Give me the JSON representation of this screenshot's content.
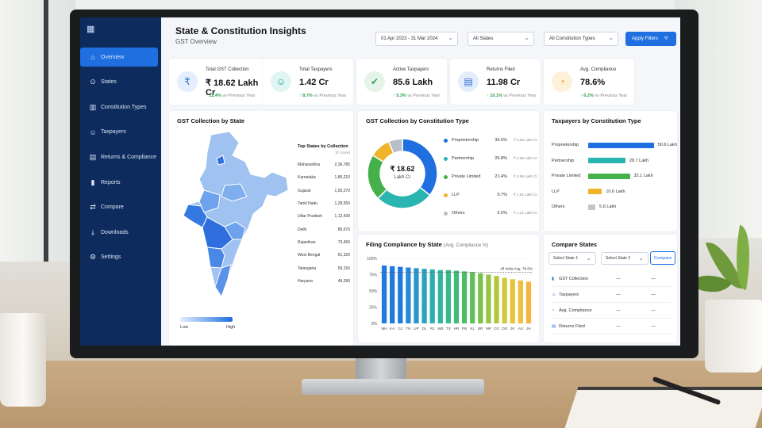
{
  "nav": {
    "items": [
      {
        "icon": "home-icon",
        "glyph": "⌂",
        "label": "Overview"
      },
      {
        "icon": "location-pin-icon",
        "glyph": "⊙",
        "label": "States"
      },
      {
        "icon": "building-icon",
        "glyph": "▥",
        "label": "Constitution Types"
      },
      {
        "icon": "users-icon",
        "glyph": "☺",
        "label": "Taxpayers"
      },
      {
        "icon": "document-icon",
        "glyph": "▤",
        "label": "Returns & Compliance"
      },
      {
        "icon": "bar-chart-icon",
        "glyph": "▮",
        "label": "Reports"
      },
      {
        "icon": "compare-arrows-icon",
        "glyph": "⇄",
        "label": "Compare"
      },
      {
        "icon": "download-icon",
        "glyph": "⤓",
        "label": "Downloads"
      },
      {
        "icon": "gear-icon",
        "glyph": "⚙",
        "label": "Settings"
      }
    ]
  },
  "header": {
    "title": "State & Constitution Insights",
    "subtitle": "GST Overview",
    "date_range": "01 Apr 2023 - 31 Mar 2024",
    "state_filter": "All States",
    "constitution_filter": "All Constitution Types",
    "apply_label": "Apply Filters"
  },
  "kpis": [
    {
      "label": "Total GST Collection",
      "value": "₹ 18.62 Lakh Cr",
      "change": "↑ 12.4%",
      "note": "vs Previous Year",
      "glyph": "₹",
      "color": "#1f6fe0",
      "bg": "#e4eefc"
    },
    {
      "label": "Total Taxpayers",
      "value": "1.42 Cr",
      "change": "↑ 8.7%",
      "note": "vs Previous Year",
      "glyph": "☺",
      "color": "#18a89a",
      "bg": "#e1f5f2"
    },
    {
      "label": "Active Taxpayers",
      "value": "85.6 Lakh",
      "change": "↑ 5.3%",
      "note": "vs Previous Year",
      "glyph": "✔",
      "color": "#3aa655",
      "bg": "#e5f4e8"
    },
    {
      "label": "Returns Filed",
      "value": "11.98 Cr",
      "change": "↑ 10.1%",
      "note": "vs Previous Year",
      "glyph": "▤",
      "color": "#2d6fd6",
      "bg": "#e4edfb"
    },
    {
      "label": "Avg. Compliance",
      "value": "78.6%",
      "change": "↑ 6.2%",
      "note": "vs Previous Year",
      "glyph": "◔",
      "color": "#f0a21d",
      "bg": "#fdf1dc"
    }
  ],
  "state_map": {
    "title": "GST Collection by State",
    "legend_low": "Low",
    "legend_high": "High",
    "table_title": "Top States by Collection",
    "table_unit": "(₹ Crore)",
    "rows": [
      {
        "state": "Maharashtra",
        "value": "2,36,785"
      },
      {
        "state": "Karnataka",
        "value": "1,85,210"
      },
      {
        "state": "Gujarat",
        "value": "1,50,270"
      },
      {
        "state": "Tamil Nadu",
        "value": "1,28,550"
      },
      {
        "state": "Uttar Pradesh",
        "value": "1,12,430"
      },
      {
        "state": "Delhi",
        "value": "85,670"
      },
      {
        "state": "Rajasthan",
        "value": "73,450"
      },
      {
        "state": "West Bengal",
        "value": "61,320"
      },
      {
        "state": "Telangana",
        "value": "59,150"
      },
      {
        "state": "Haryana",
        "value": "49,280"
      }
    ]
  },
  "donut": {
    "title": "GST Collection by Constitution Type",
    "center_value": "₹ 18.62",
    "center_unit": "Lakh Cr",
    "items": [
      {
        "name": "Proprietorship",
        "pct": "35.6%",
        "share": 35.6,
        "amt": "₹ 6.63 Lakh Cr",
        "color": "#1f6fe0"
      },
      {
        "name": "Partnership",
        "pct": "26.8%",
        "share": 26.8,
        "amt": "₹ 4.99 Lakh Cr",
        "color": "#2bb5b0"
      },
      {
        "name": "Private Limited",
        "pct": "21.4%",
        "share": 21.4,
        "amt": "₹ 3.98 Lakh Cr",
        "color": "#46b04a"
      },
      {
        "name": "LLP",
        "pct": "9.7%",
        "share": 9.7,
        "amt": "₹ 1.81 Lakh Cr",
        "color": "#f0b429"
      },
      {
        "name": "Others",
        "pct": "6.5%",
        "share": 6.5,
        "amt": "₹ 1.21 Lakh Cr",
        "color": "#b8bdc6"
      }
    ]
  },
  "taxpayers": {
    "title": "Taxpayers by Constitution Type",
    "items": [
      {
        "name": "Proprietorship",
        "value": 50.6,
        "label": "50.6 Lakh",
        "color": "#1f6fe0"
      },
      {
        "name": "Partnership",
        "value": 28.7,
        "label": "28.7 Lakh",
        "color": "#2bb5b0"
      },
      {
        "name": "Private Limited",
        "value": 32.1,
        "label": "32.1 Lakh",
        "color": "#46b04a"
      },
      {
        "name": "LLP",
        "value": 10.6,
        "label": "10.6 Lakh",
        "color": "#f0b429"
      },
      {
        "name": "Others",
        "value": 5.6,
        "label": "5.6 Lakh",
        "color": "#c0c4cc"
      }
    ]
  },
  "chart_data": {
    "type": "bar",
    "title": "Filing Compliance by State",
    "subtitle": "(Avg. Compliance %)",
    "categories": [
      "MH",
      "KA",
      "GJ",
      "TN",
      "UP",
      "DL",
      "RJ",
      "WB",
      "TS",
      "HR",
      "PB",
      "KL",
      "BR",
      "MP",
      "CG",
      "OD",
      "JK",
      "AS",
      "JH"
    ],
    "values": [
      89,
      88,
      87,
      86,
      85,
      84,
      83,
      82,
      82,
      81,
      80,
      79,
      77,
      75,
      73,
      70,
      68,
      66,
      64
    ],
    "ylim": [
      0,
      100
    ],
    "yticks": [
      "0%",
      "25%",
      "50%",
      "75%",
      "100%"
    ],
    "reference_line": {
      "value": 78.6,
      "label": "All India Avg. 78.6%"
    },
    "colors": [
      "#1f7ae0",
      "#1f7ae0",
      "#1f7ae0",
      "#2389d8",
      "#2696cc",
      "#2aa3bf",
      "#2eadb0",
      "#32b5a0",
      "#38b98e",
      "#40bb7a",
      "#4cbd66",
      "#5fbf55",
      "#78c24a",
      "#95c542",
      "#b2c83c",
      "#cfc83a",
      "#e6c43a",
      "#f2bd3c",
      "#f6b43f"
    ]
  },
  "compare": {
    "title": "Compare States",
    "state1": "Select State 1",
    "state2": "Select State 2",
    "button": "Compare",
    "rows": [
      {
        "icon": "bar-chart-icon",
        "glyph": "▮",
        "label": "GST Collection",
        "a": "—",
        "b": "—"
      },
      {
        "icon": "users-icon",
        "glyph": "☺",
        "label": "Taxpayers",
        "a": "—",
        "b": "—"
      },
      {
        "icon": "speedometer-icon",
        "glyph": "◔",
        "label": "Avg. Compliance",
        "a": "—",
        "b": "—"
      },
      {
        "icon": "document-icon",
        "glyph": "▤",
        "label": "Returns Filed",
        "a": "—",
        "b": "—"
      }
    ]
  }
}
